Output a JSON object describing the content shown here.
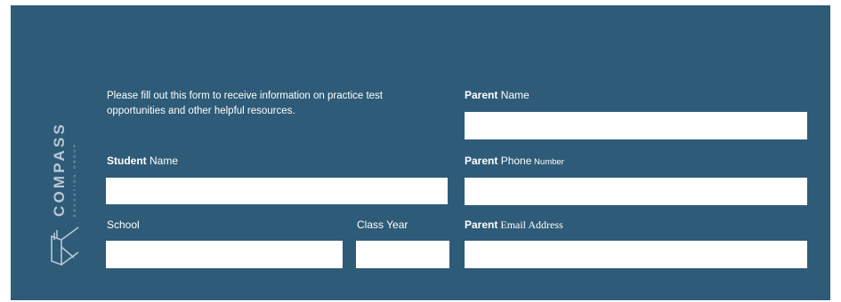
{
  "logo": {
    "brand": "COMPASS",
    "tagline": "EDUCATION GROUP",
    "accent_color": "#e8464a"
  },
  "form": {
    "intro": "Please fill out this form to receive information on practice test opportunities and other helpful resources.",
    "student_name": {
      "bold": "Student",
      "rest": " Name",
      "value": ""
    },
    "school": {
      "label": "School",
      "value": ""
    },
    "class_year": {
      "label": "Class Year",
      "value": ""
    },
    "parent_name": {
      "bold": "Parent",
      "rest": " Name",
      "value": ""
    },
    "parent_phone": {
      "bold": "Parent",
      "rest1": " Phone",
      "rest2": " Number",
      "value": ""
    },
    "parent_email": {
      "bold": "Parent",
      "rest": " Email Address",
      "value": ""
    }
  },
  "colors": {
    "panel": "#2e5b78",
    "field": "#ffffff",
    "text": "#ffffff"
  }
}
